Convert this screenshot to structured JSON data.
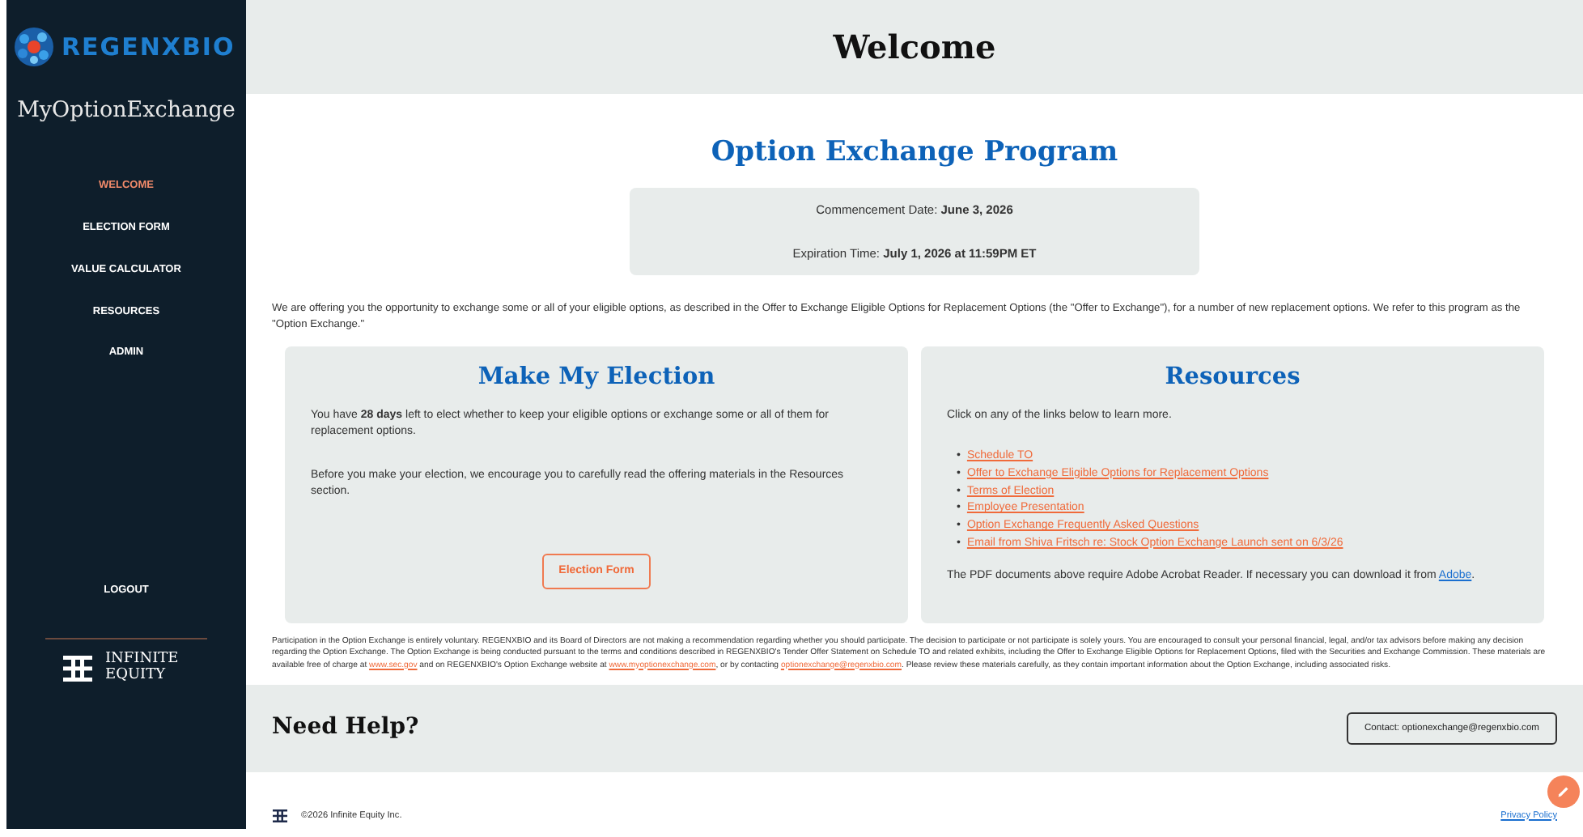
{
  "sidebar": {
    "logo": "REGEN**X**BIO",
    "app_name": "MyOptionExchange",
    "items": [
      {
        "label": "WELCOME",
        "selected": true
      },
      {
        "label": "ELECTION FORM",
        "selected": false
      },
      {
        "label": "VALUE CALCULATOR",
        "selected": false
      },
      {
        "label": "RESOURCES",
        "selected": false
      },
      {
        "label": "ADMIN",
        "selected": false
      }
    ],
    "logout": "LOGOUT",
    "brand": "INFINITE EQUITY"
  },
  "header": {
    "title": "Welcome"
  },
  "program": {
    "title": "Option Exchange Program",
    "dates": [
      {
        "label": "Commencement Date:",
        "value": "June 3, 2026"
      },
      {
        "label": "Expiration Time:",
        "value": "July 1, 2026 at 11:59PM ET"
      }
    ]
  },
  "intro": "We are offering you the opportunity to exchange some or all of your eligible options, as described in the Offer to Exchange Eligible Options for Replacement Options (the \"Offer to Exchange\"), for a number of new replacement options. We refer to this program as the \"Option Exchange.\"",
  "election": {
    "title": "Make My Election",
    "paragraphs": [
      "You have **28 days** left to elect whether to keep your eligible options or exchange some or all of them for replacement options.",
      "Before you make your election, we encourage you to carefully read the offering materials in the Resources section."
    ],
    "button": "Election Form"
  },
  "resources": {
    "title": "Resources",
    "lead": "Click on any of the links below to learn more.",
    "links": [
      {
        "marker": "•",
        "text": "Schedule TO"
      },
      {
        "marker": "•",
        "text": "Offer to Exchange Eligible Options for Replacement Options"
      },
      {
        "marker": "•",
        "text": "Terms of Election"
      },
      {
        "marker": "•",
        "text": "Employee Presentation"
      },
      {
        "marker": "•",
        "text": "Option Exchange Frequently Asked Questions"
      },
      {
        "marker": "•",
        "text": "Email from Shiva Fritsch re: Stock Option Exchange Launch sent on 6/3/26"
      }
    ],
    "note": [
      {
        "kind": "text",
        "text": "The PDF documents above require Adobe Acrobat Reader. If necessary you can download it from "
      },
      {
        "kind": "link",
        "text": "Adobe"
      },
      {
        "kind": "text",
        "text": "."
      }
    ]
  },
  "disclaimer": [
    {
      "kind": "text",
      "text": "Participation in the Option Exchange is entirely voluntary. REGENXBIO and its Board of Directors are not making a recommendation regarding whether you should participate. The decision to participate or not participate is solely yours. You are encouraged to consult your personal financial, legal, and/or tax advisors before making any decision regarding the Option Exchange. The Option Exchange is being conducted pursuant to the terms and conditions described in REGENXBIO's Tender Offer Statement on Schedule TO and related exhibits, including the Offer to Exchange Eligible Options for Replacement Options, filed with the Securities and Exchange Commission. These materials are available free of charge at "
    },
    {
      "kind": "link",
      "text": "www.sec.gov"
    },
    {
      "kind": "text",
      "text": " and on REGENXBIO's Option Exchange website at "
    },
    {
      "kind": "link",
      "text": "www.myoptionexchange.com"
    },
    {
      "kind": "text",
      "text": ", or by contacting "
    },
    {
      "kind": "link",
      "text": "optionexchange@regenxbio.com"
    },
    {
      "kind": "text",
      "text": ". Please review these materials carefully, as they contain important information about the Option Exchange, including associated risks."
    }
  ],
  "help": {
    "title": "Need Help?",
    "contact": "Contact: optionexchange@regenxbio.com"
  },
  "footer": {
    "copyright": "©2026 Infinite Equity Inc.",
    "privacy": "Privacy Policy"
  }
}
